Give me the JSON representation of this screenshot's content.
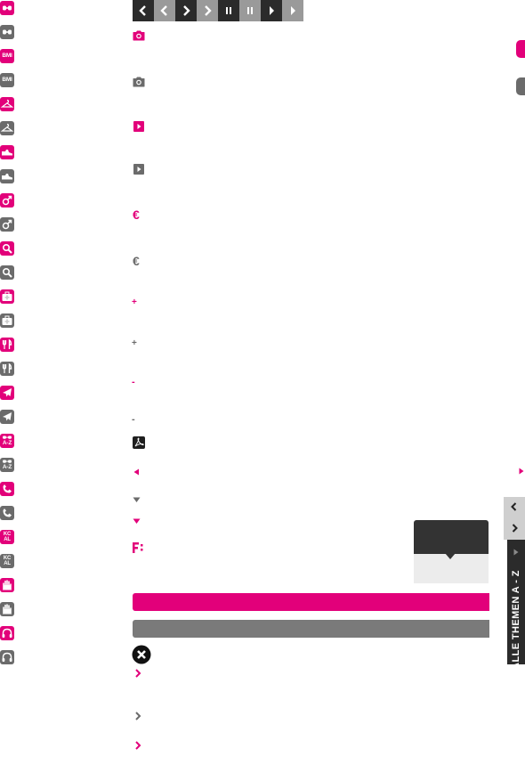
{
  "brand_color": "#e2007a",
  "muted_color": "#6b6b6b",
  "sidebar_icons": [
    {
      "name": "link-icon-pink",
      "label": ""
    },
    {
      "name": "link-icon-grey",
      "label": ""
    },
    {
      "name": "bmi-icon-pink",
      "label": "BMI"
    },
    {
      "name": "bmi-icon-grey",
      "label": "BMI"
    },
    {
      "name": "hanger-icon-pink",
      "label": ""
    },
    {
      "name": "hanger-icon-grey",
      "label": ""
    },
    {
      "name": "shoe-icon-pink",
      "label": ""
    },
    {
      "name": "shoe-icon-grey",
      "label": ""
    },
    {
      "name": "gender-icon-pink",
      "label": ""
    },
    {
      "name": "gender-icon-grey",
      "label": ""
    },
    {
      "name": "search-icon-pink",
      "label": ""
    },
    {
      "name": "search-icon-grey",
      "label": ""
    },
    {
      "name": "medical-bag-icon-pink",
      "label": ""
    },
    {
      "name": "medical-bag-icon-grey",
      "label": ""
    },
    {
      "name": "cutlery-icon-pink",
      "label": ""
    },
    {
      "name": "cutlery-icon-grey",
      "label": ""
    },
    {
      "name": "plane-icon-pink",
      "label": ""
    },
    {
      "name": "plane-icon-grey",
      "label": ""
    },
    {
      "name": "az-icon-pink",
      "label": "A-Z"
    },
    {
      "name": "az-icon-grey",
      "label": "A-Z"
    },
    {
      "name": "phone-icon-pink",
      "label": ""
    },
    {
      "name": "phone-icon-grey",
      "label": ""
    },
    {
      "name": "kcal-icon-pink",
      "label": "KC\nAL"
    },
    {
      "name": "kcal-icon-grey",
      "label": "KC\nAL"
    },
    {
      "name": "hand-icon-pink",
      "label": ""
    },
    {
      "name": "hand-icon-grey",
      "label": ""
    },
    {
      "name": "headphones-icon-pink",
      "label": ""
    },
    {
      "name": "headphones-icon-grey",
      "label": ""
    }
  ],
  "media_controls": [
    {
      "name": "prev-dark-button",
      "icon": "chevron-left-icon"
    },
    {
      "name": "prev-light-button",
      "icon": "chevron-left-icon"
    },
    {
      "name": "next-dark-button",
      "icon": "chevron-right-icon"
    },
    {
      "name": "next-light-button",
      "icon": "chevron-right-icon"
    },
    {
      "name": "pause-dark-button",
      "icon": "pause-icon"
    },
    {
      "name": "pause-light-button",
      "icon": "pause-icon"
    },
    {
      "name": "play-dark-button",
      "icon": "play-icon"
    },
    {
      "name": "play-light-button",
      "icon": "play-icon"
    }
  ],
  "currency_symbol": "€",
  "plus_symbol": "+",
  "minus_symbol": "-",
  "pdf_icon": "pdf-icon",
  "vertical_tab": {
    "label": "ALLE THEMEN  A - Z"
  }
}
